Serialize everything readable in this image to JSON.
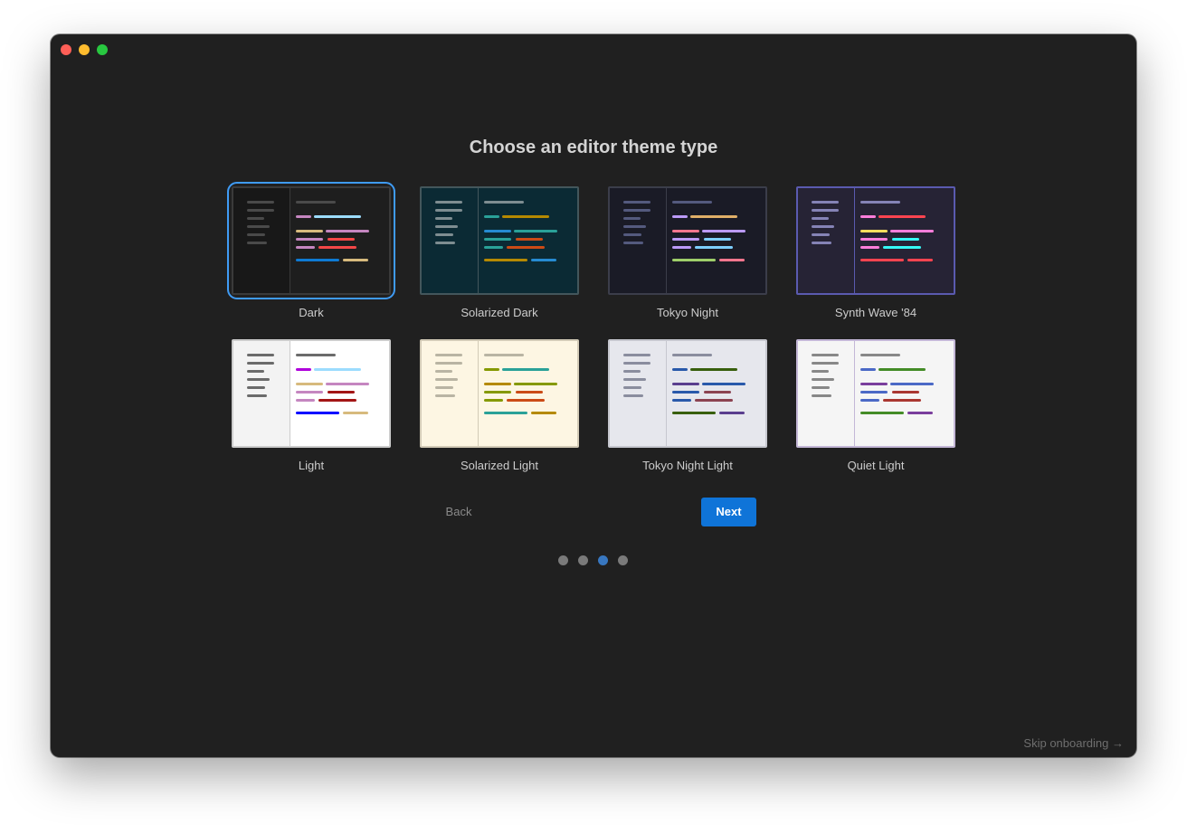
{
  "title": "Choose an editor theme type",
  "themes": [
    {
      "label": "Dark",
      "selected": true,
      "bg": "#1e1e1e",
      "side": "#181818",
      "frame": "#3a3a3a",
      "muted": "#4a4a4a",
      "top": "#151515",
      "c": [
        "#c586c0",
        "#9cdcfe",
        "#d7ba7d",
        "#c586c0",
        "#c586c0",
        "#f44747",
        "#c586c0",
        "#f44747",
        "#0e7ad3",
        "#d7ba7d"
      ]
    },
    {
      "label": "Solarized Dark",
      "selected": false,
      "bg": "#0b2a34",
      "side": "#0b2a34",
      "frame": "#43565b",
      "muted": "#7e8d91",
      "top": "#0b2a34",
      "c": [
        "#2aa198",
        "#b58900",
        "#268bd2",
        "#2aa198",
        "#2aa198",
        "#cb4b16",
        "#2aa198",
        "#cb4b16",
        "#b58900",
        "#268bd2"
      ]
    },
    {
      "label": "Tokyo Night",
      "selected": false,
      "bg": "#1a1b26",
      "side": "#1a1b26",
      "frame": "#3b3d4a",
      "muted": "#545a7e",
      "top": "#1a1b26",
      "c": [
        "#bb9af7",
        "#e0af68",
        "#f7768e",
        "#bb9af7",
        "#bb9af7",
        "#7dcfff",
        "#bb9af7",
        "#7dcfff",
        "#9ece6a",
        "#f7768e"
      ]
    },
    {
      "label": "Synth Wave '84",
      "selected": false,
      "bg": "#262335",
      "side": "#262335",
      "frame": "#5a5aaf",
      "muted": "#8583b6",
      "top": "#262335",
      "c": [
        "#ff7edb",
        "#fe4450",
        "#fede5d",
        "#ff7edb",
        "#ff7edb",
        "#36f9f6",
        "#ff7edb",
        "#36f9f6",
        "#fe4450",
        "#fe4450"
      ]
    },
    {
      "label": "Light",
      "selected": false,
      "bg": "#ffffff",
      "side": "#f3f3f3",
      "frame": "#cccccc",
      "muted": "#6b6b6b",
      "top": "#f3f3f3",
      "c": [
        "#af00db",
        "#9cdcfe",
        "#d7ba7d",
        "#c586c0",
        "#c586c0",
        "#a31515",
        "#c586c0",
        "#a31515",
        "#0000ff",
        "#d7ba7d"
      ]
    },
    {
      "label": "Solarized Light",
      "selected": false,
      "bg": "#fdf6e3",
      "side": "#fdf6e3",
      "frame": "#d3cbb7",
      "muted": "#b9b4a3",
      "top": "#fdf6e3",
      "c": [
        "#859900",
        "#2aa198",
        "#b58900",
        "#859900",
        "#859900",
        "#cb4b16",
        "#859900",
        "#cb4b16",
        "#2aa198",
        "#b58900"
      ]
    },
    {
      "label": "Tokyo Night Light",
      "selected": false,
      "bg": "#e6e7ed",
      "side": "#e6e7ed",
      "frame": "#c6c7cf",
      "muted": "#8a8d9e",
      "top": "#e6e7ed",
      "c": [
        "#2959aa",
        "#385f0d",
        "#5a3e8e",
        "#2959aa",
        "#2959aa",
        "#8c4351",
        "#2959aa",
        "#8c4351",
        "#385f0d",
        "#5a3e8e"
      ]
    },
    {
      "label": "Quiet Light",
      "selected": false,
      "bg": "#f5f5f5",
      "side": "#f5f5f5",
      "frame": "#c4b7d7",
      "muted": "#888888",
      "top": "#f5f5f5",
      "c": [
        "#4b69c6",
        "#448c27",
        "#7a3e9d",
        "#4b69c6",
        "#4b69c6",
        "#aa3731",
        "#4b69c6",
        "#aa3731",
        "#448c27",
        "#7a3e9d"
      ]
    }
  ],
  "buttons": {
    "back": "Back",
    "next": "Next"
  },
  "progress": {
    "total": 4,
    "current": 3
  },
  "skip": "Skip onboarding →"
}
